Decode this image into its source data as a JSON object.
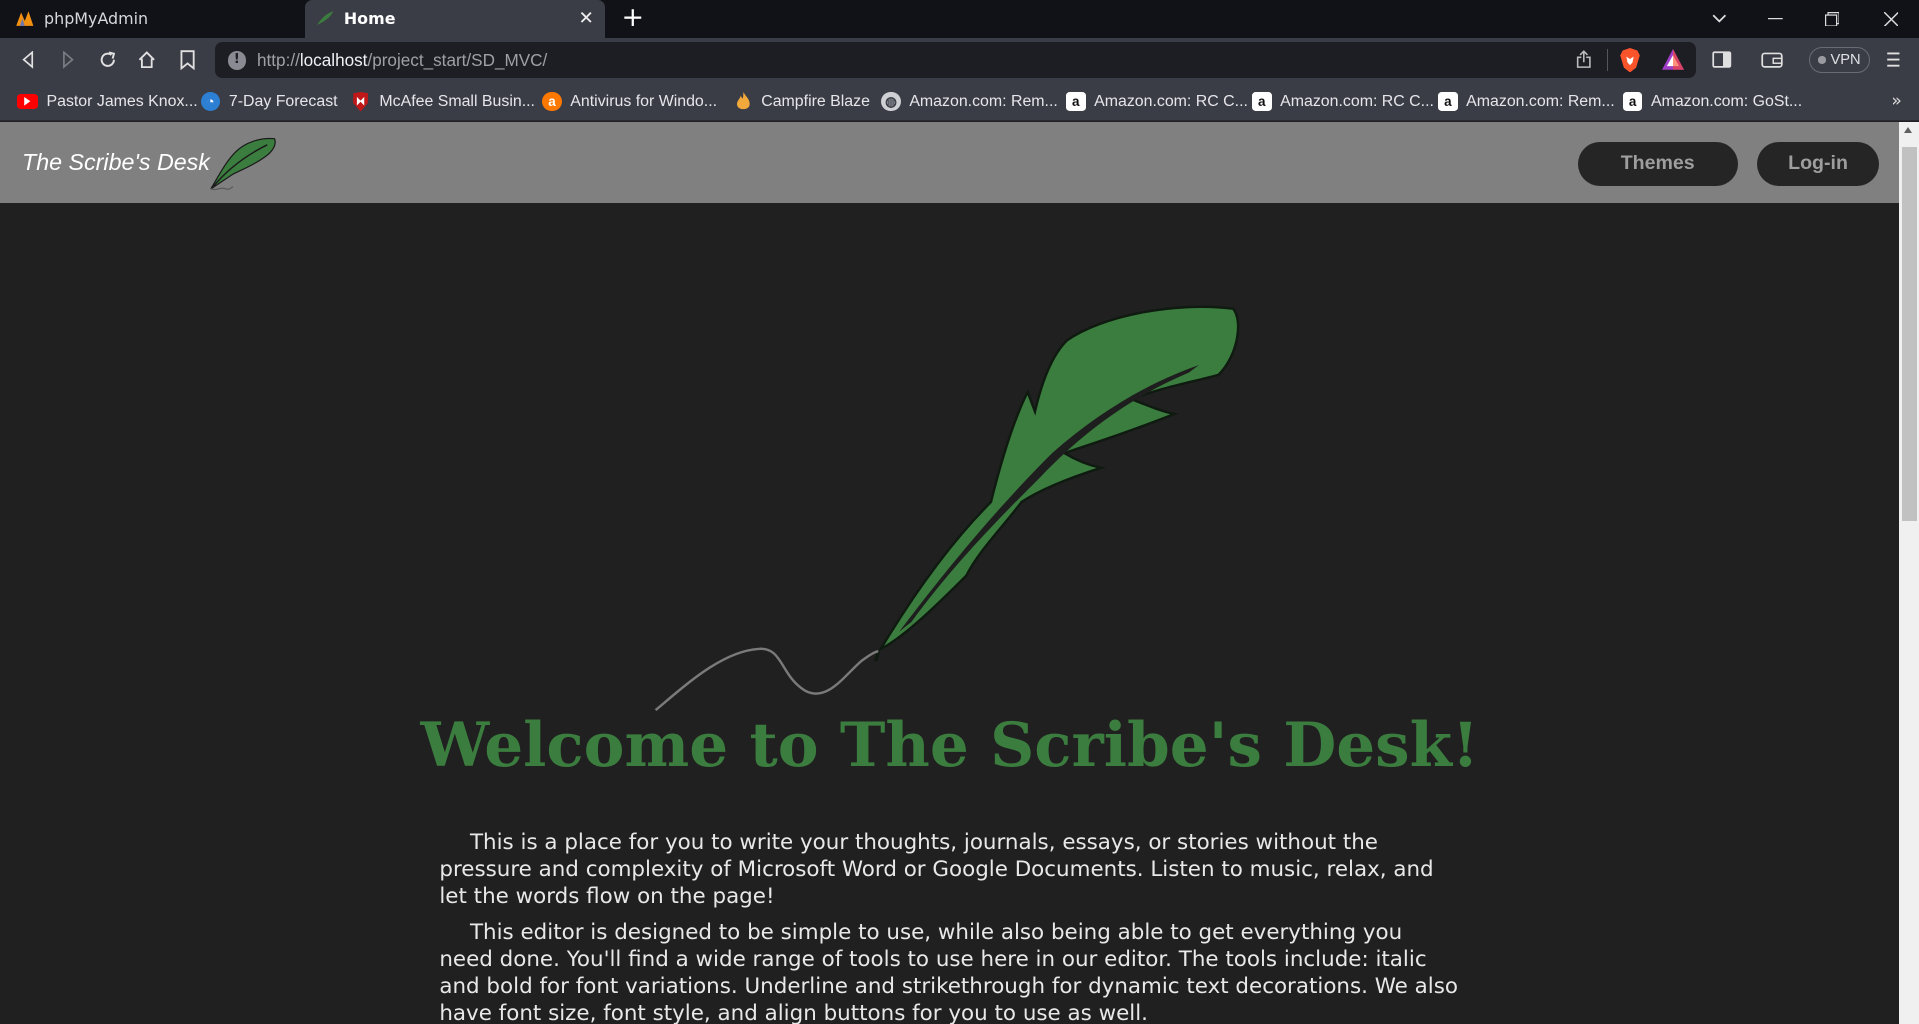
{
  "browser": {
    "tabs": [
      {
        "label": "phpMyAdmin",
        "active": false
      },
      {
        "label": "Home",
        "active": true
      }
    ],
    "url_scheme": "http://",
    "url_host": "localhost",
    "url_path": "/project_start/SD_MVC/",
    "vpn_label": "VPN",
    "bookmarks": [
      {
        "label": "Pastor James Knox...",
        "icon": "youtube-icon"
      },
      {
        "label": "7-Day Forecast",
        "icon": "weather-icon"
      },
      {
        "label": "McAfee Small Busin...",
        "icon": "mcafee-icon"
      },
      {
        "label": "Antivirus for Windo...",
        "icon": "avast-icon"
      },
      {
        "label": "Campfire Blaze",
        "icon": "flame-icon"
      },
      {
        "label": "Amazon.com: Rem...",
        "icon": "globe-icon"
      },
      {
        "label": "Amazon.com: RC C...",
        "icon": "amazon-icon"
      },
      {
        "label": "Amazon.com: RC C...",
        "icon": "amazon-icon"
      },
      {
        "label": "Amazon.com: Rem...",
        "icon": "amazon-icon"
      },
      {
        "label": "Amazon.com: GoSt...",
        "icon": "amazon-icon"
      }
    ],
    "bookmarks_more": "»"
  },
  "site": {
    "brand": "The Scribe's Desk",
    "nav": {
      "themes": "Themes",
      "login": "Log-in"
    },
    "welcome": "Welcome to The Scribe's Desk!",
    "paragraphs": [
      "This is a place for you to write your thoughts, journals, essays, or stories without the pressure and complexity of Microsoft Word or Google Documents. Listen to music, relax, and let the words flow on the page!",
      "This editor is designed to be simple to use, while also being able to get everything you need done. You'll find a wide range of tools to use here in our editor. The tools include: italic and bold for font variations. Underline and strikethrough for dynamic text decorations. We also have font size, font style, and align buttons for you to use as well."
    ],
    "colors": {
      "accent": "#3b7d3e",
      "header": "#808080",
      "background": "#202020"
    }
  }
}
